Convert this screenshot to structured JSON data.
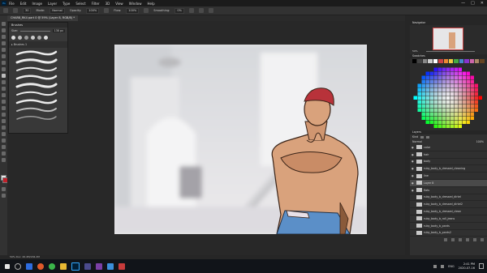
{
  "app": {
    "menu": [
      "File",
      "Edit",
      "Image",
      "Layer",
      "Type",
      "Select",
      "Filter",
      "3D",
      "View",
      "Window",
      "Help"
    ],
    "window_controls": [
      "—",
      "□",
      "✕"
    ]
  },
  "options": {
    "mode_label": "Mode:",
    "mode_value": "Normal",
    "opacity_label": "Opacity:",
    "opacity_value": "100%",
    "flow_label": "Flow:",
    "flow_value": "100%",
    "smoothing_label": "Smoothing:",
    "smoothing_value": "0%",
    "size_value": "30"
  },
  "document": {
    "tab_title": "CHAR8_RK4 part 0 @ 59% (Layer 8, RGB/8) *"
  },
  "brush_panel": {
    "title": "Brushes",
    "size_label": "Size:",
    "size_value": "138 px",
    "group_name": "Brushes 1"
  },
  "navigator": {
    "title": "Navigator",
    "zoom": "59%"
  },
  "swatches": {
    "title": "Swatches"
  },
  "layers": {
    "title": "Layers",
    "kind_label": "Kind",
    "blend_mode": "Normal",
    "opacity": "100%",
    "rows": [
      {
        "name": "color",
        "visible": true
      },
      {
        "name": "hair",
        "visible": true
      },
      {
        "name": "body",
        "visible": true
      },
      {
        "name": "ruby_body_b_dressed_cleaning",
        "visible": true
      },
      {
        "name": "line",
        "visible": true
      },
      {
        "name": "Layer 8",
        "visible": true
      },
      {
        "name": "flats",
        "visible": true
      },
      {
        "name": "ruby_body_b_dressed_dirtel",
        "visible": false
      },
      {
        "name": "ruby_body_b_dressed_dirtel2",
        "visible": false
      },
      {
        "name": "ruby_body_b_dressed_clean",
        "visible": false
      },
      {
        "name": "ruby_body_b_roll_jeans",
        "visible": false
      },
      {
        "name": "ruby_body_b_pants",
        "visible": false
      },
      {
        "name": "ruby_body_b_pants2",
        "visible": false
      }
    ]
  },
  "status": {
    "text": "59%   Doc: 26.4M/184.2M"
  },
  "taskbar": {
    "lang": "ENG",
    "time": "2:41 PM",
    "date": "2020-07-16"
  },
  "colors": {
    "fg": "#e8e8e8",
    "bg": "#c0202a",
    "ps_blue": "#31a8ff",
    "bandana": "#b8323a",
    "skin": "#d9a27c",
    "jeans": "#5b8fc8"
  }
}
